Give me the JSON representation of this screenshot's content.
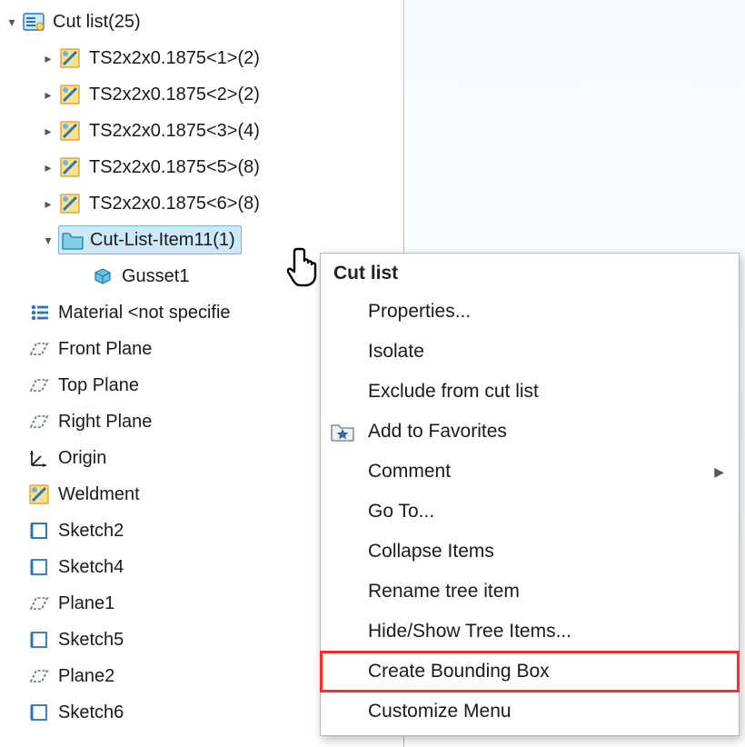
{
  "tree": {
    "root": {
      "label": "Cut list(25)"
    },
    "weldItems": [
      {
        "label": "TS2x2x0.1875<1>(2)"
      },
      {
        "label": "TS2x2x0.1875<2>(2)"
      },
      {
        "label": "TS2x2x0.1875<3>(4)"
      },
      {
        "label": "TS2x2x0.1875<5>(8)"
      },
      {
        "label": "TS2x2x0.1875<6>(8)"
      }
    ],
    "selected": {
      "label": "Cut-List-Item11(1)"
    },
    "selectedChild": {
      "label": "Gusset1"
    },
    "material": {
      "label": "Material <not specifie"
    },
    "planes": [
      {
        "label": "Front Plane"
      },
      {
        "label": "Top Plane"
      },
      {
        "label": "Right Plane"
      }
    ],
    "origin": {
      "label": "Origin"
    },
    "weldment": {
      "label": "Weldment"
    },
    "sketches": [
      {
        "label": "Sketch2"
      },
      {
        "label": "Sketch4"
      },
      {
        "label": "Plane1",
        "type": "plane"
      },
      {
        "label": "Sketch5"
      },
      {
        "label": "Plane2",
        "type": "plane"
      },
      {
        "label": "Sketch6"
      }
    ]
  },
  "contextMenu": {
    "header": "Cut list",
    "items": [
      {
        "label": "Properties...",
        "icon": null,
        "submenu": false
      },
      {
        "label": "Isolate",
        "icon": null,
        "submenu": false
      },
      {
        "label": "Exclude from cut list",
        "icon": null,
        "submenu": false
      },
      {
        "label": "Add to Favorites",
        "icon": "favorite",
        "submenu": false
      },
      {
        "label": "Comment",
        "icon": null,
        "submenu": true
      },
      {
        "label": "Go To...",
        "icon": null,
        "submenu": false
      },
      {
        "label": "Collapse Items",
        "icon": null,
        "submenu": false
      },
      {
        "label": "Rename tree item",
        "icon": null,
        "submenu": false
      },
      {
        "label": "Hide/Show Tree Items...",
        "icon": null,
        "submenu": false
      },
      {
        "label": "Create Bounding Box",
        "icon": null,
        "submenu": false,
        "highlight": true
      },
      {
        "label": "Customize Menu",
        "icon": null,
        "submenu": false
      }
    ]
  }
}
